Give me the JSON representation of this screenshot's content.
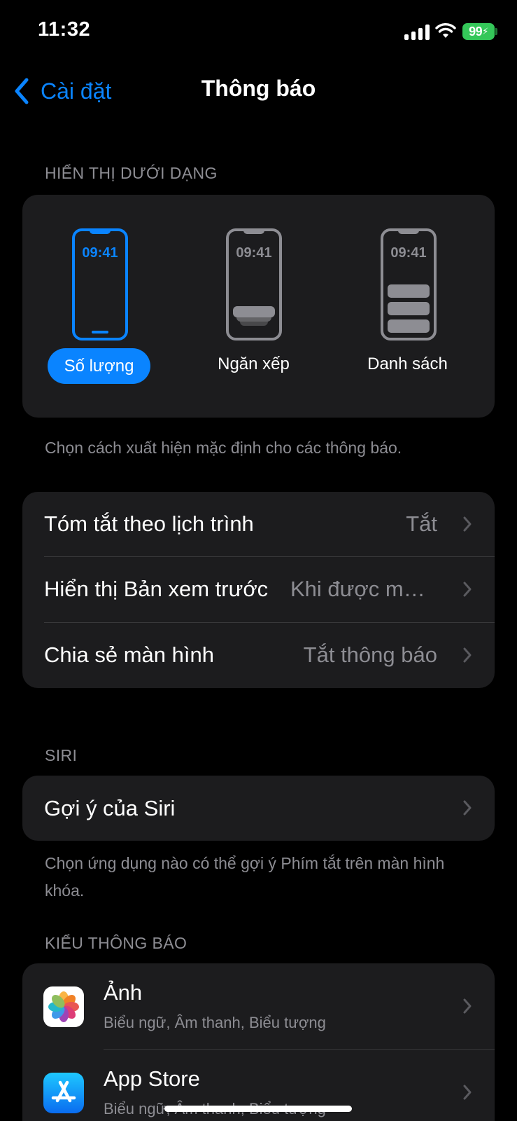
{
  "status_bar": {
    "time": "11:32",
    "battery": "99"
  },
  "nav": {
    "back_label": "Cài đặt",
    "title": "Thông báo"
  },
  "display_section": {
    "header": "HIỂN THỊ DƯỚI DẠNG",
    "options": [
      {
        "label": "Số lượng",
        "time": "09:41",
        "selected": true
      },
      {
        "label": "Ngăn xếp",
        "time": "09:41",
        "selected": false
      },
      {
        "label": "Danh sách",
        "time": "09:41",
        "selected": false
      }
    ],
    "footer": "Chọn cách xuất hiện mặc định cho các thông báo."
  },
  "settings_rows": [
    {
      "label": "Tóm tắt theo lịch trình",
      "value": "Tắt"
    },
    {
      "label": "Hiển thị Bản xem trước",
      "value": "Khi được mở khóa"
    },
    {
      "label": "Chia sẻ màn hình",
      "value": "Tắt thông báo"
    }
  ],
  "siri_section": {
    "header": "SIRI",
    "row_label": "Gợi ý của Siri",
    "footer": "Chọn ứng dụng nào có thể gợi ý Phím tắt trên màn hình khóa."
  },
  "notification_style_section": {
    "header": "KIỂU THÔNG BÁO",
    "apps": [
      {
        "name": "Ảnh",
        "subtitle": "Biểu ngữ, Âm thanh, Biểu tượng",
        "icon": "photos-icon"
      },
      {
        "name": "App Store",
        "subtitle": "Biểu ngữ, Âm thanh, Biểu tượng",
        "icon": "app-store-icon"
      }
    ]
  },
  "colors": {
    "accent": "#0a84ff",
    "background": "#000000",
    "card": "#1c1c1e",
    "secondary_text": "#8d8d93",
    "battery": "#34c759"
  }
}
